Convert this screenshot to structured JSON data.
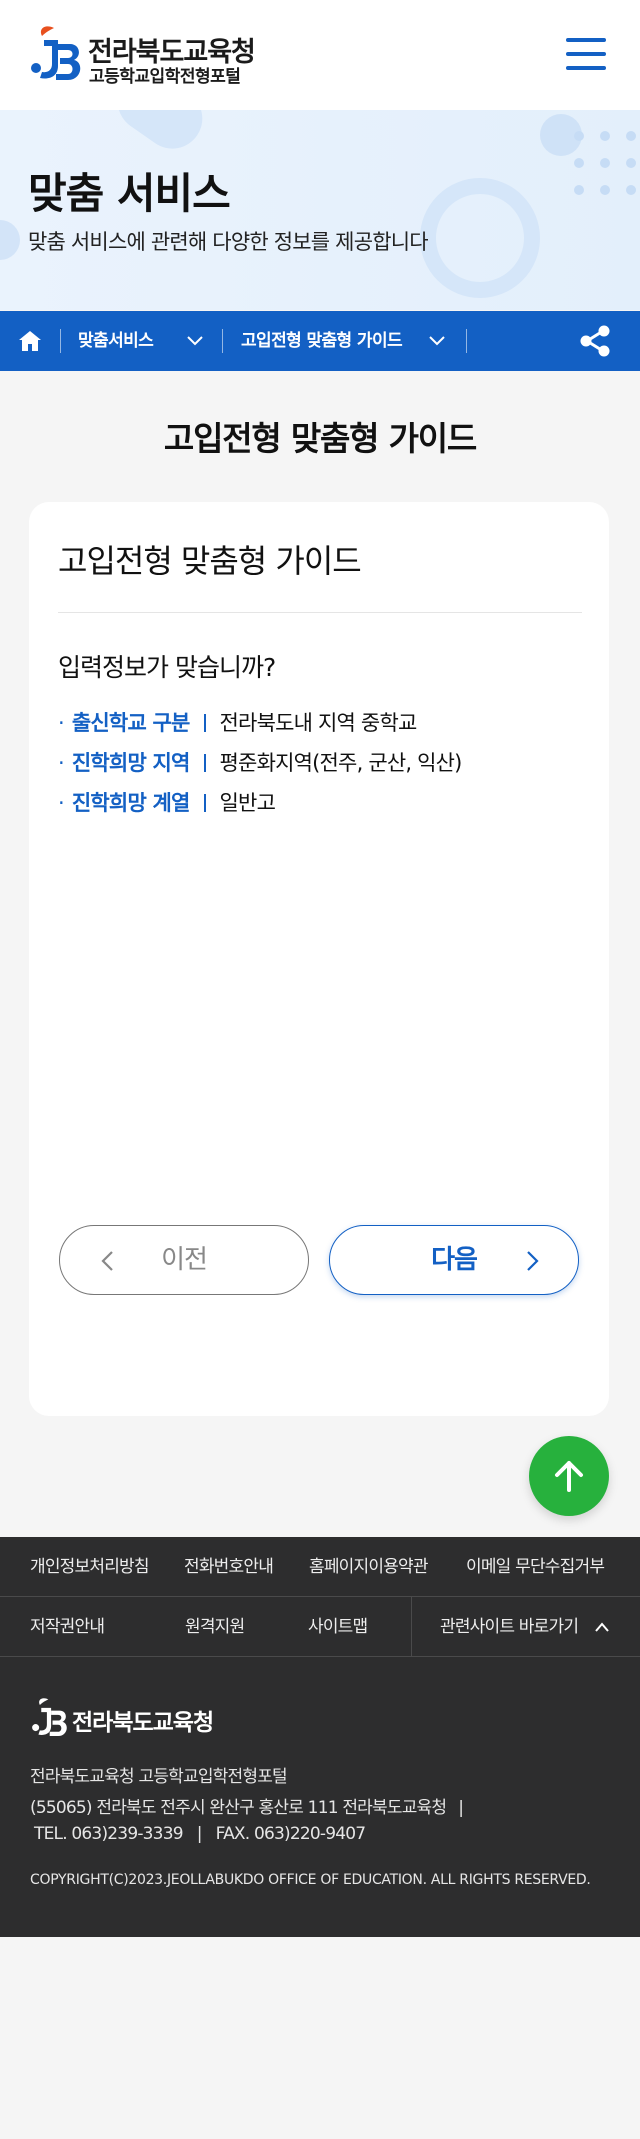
{
  "header": {
    "org_name": "전라북도교육청",
    "portal_name": "고등학교입학전형포털"
  },
  "banner": {
    "title": "맞춤 서비스",
    "description": "맞춤 서비스에 관련해 다양한 정보를 제공합니다"
  },
  "location": {
    "items": [
      {
        "label": "맞춤서비스"
      },
      {
        "label": "고입전형 맞춤형 가이드"
      }
    ]
  },
  "main": {
    "page_title": "고입전형 맞춤형 가이드",
    "card": {
      "title": "고입전형 맞춤형 가이드",
      "question": "입력정보가 맞습니까?",
      "info": [
        {
          "bullet": "·",
          "label": "출신학교 구분",
          "value": "전라북도내 지역 중학교"
        },
        {
          "bullet": "·",
          "label": "진학희망 지역",
          "value": "평준화지역(전주, 군산, 익산)"
        },
        {
          "bullet": "·",
          "label": "진학희망 계열",
          "value": "일반고"
        }
      ],
      "prev_label": "이전",
      "next_label": "다음"
    }
  },
  "footer": {
    "links_row1": [
      "개인정보처리방침",
      "전화번호안내",
      "홈페이지이용약관",
      "이메일 무단수집거부"
    ],
    "links_row2": [
      "저작권안내",
      "원격지원",
      "사이트맵"
    ],
    "related_sites_label": "관련사이트 바로가기",
    "logo_text": "전라북도교육청",
    "info_line1": "전라북도교육청 고등학교입학전형포털",
    "info_line2": "(55065) 전라북도 전주시 완산구 홍산로 111 전라북도교육청",
    "info_sep": "|",
    "tel": "TEL. 063)239-3339",
    "fax": "FAX. 063)220-9407",
    "copyright": "COPYRIGHT(C)2023.JEOLLABUKDO OFFICE OF EDUCATION. ALL RIGHTS RESERVED."
  },
  "colors": {
    "primary": "#1360c4",
    "accent_orange": "#e8501e",
    "top_button": "#27b13d",
    "footer_bg": "#2d2d2e"
  },
  "icons": [
    "logo-mark-icon",
    "menu-icon",
    "home-icon",
    "chevron-down-icon",
    "share-icon",
    "chevron-left-icon",
    "chevron-right-icon",
    "arrow-up-icon",
    "chevron-up-icon"
  ]
}
